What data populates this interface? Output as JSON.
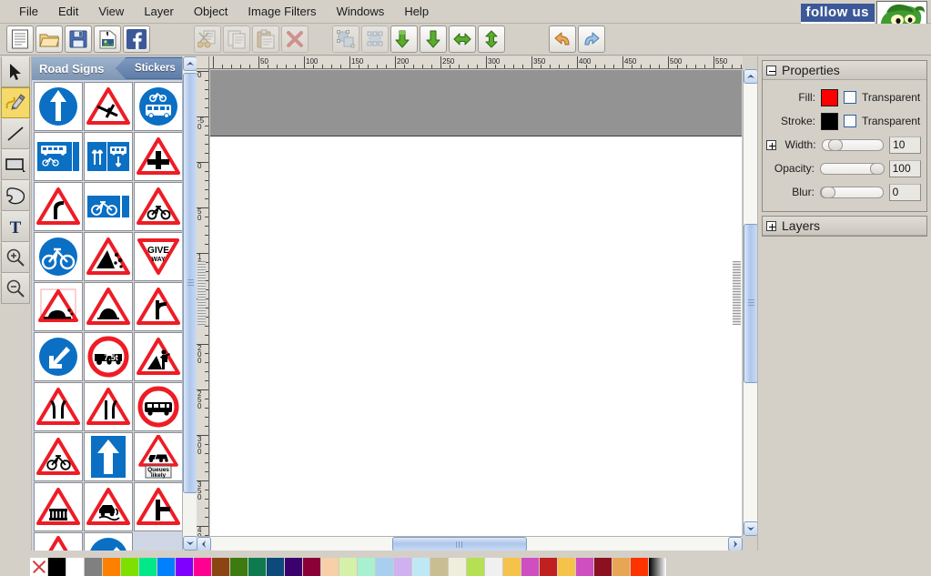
{
  "app": {
    "menu": [
      "File",
      "Edit",
      "View",
      "Layer",
      "Object",
      "Image Filters",
      "Windows",
      "Help"
    ]
  },
  "toolbar": {
    "buttons": [
      {
        "name": "new-document-button",
        "icon": "document-icon",
        "enabled": true
      },
      {
        "name": "open-folder-button",
        "icon": "folder-icon",
        "enabled": true
      },
      {
        "name": "save-button",
        "icon": "floppy-disk-icon",
        "enabled": true
      },
      {
        "name": "save-image-button",
        "icon": "image-export-icon",
        "enabled": true
      },
      {
        "name": "facebook-share-button",
        "icon": "facebook-icon",
        "enabled": true
      },
      {
        "name": "cut-button",
        "icon": "scissors-icon",
        "enabled": false
      },
      {
        "name": "copy-button",
        "icon": "copy-icon",
        "enabled": false
      },
      {
        "name": "paste-button",
        "icon": "clipboard-icon",
        "enabled": false
      },
      {
        "name": "delete-button",
        "icon": "red-x-icon",
        "enabled": false
      },
      {
        "name": "select-all-button",
        "icon": "select-shapes-icon",
        "enabled": false
      },
      {
        "name": "select-nodes-button",
        "icon": "node-points-icon",
        "enabled": false
      },
      {
        "name": "send-backward-button",
        "icon": "green-arrow-down-left-icon",
        "enabled": true
      },
      {
        "name": "send-to-back-button",
        "icon": "green-arrow-down-icon",
        "enabled": true
      },
      {
        "name": "flip-horizontal-button",
        "icon": "green-arrow-horizontal-icon",
        "enabled": true
      },
      {
        "name": "flip-vertical-button",
        "icon": "green-arrow-vertical-icon",
        "enabled": true
      },
      {
        "name": "undo-button",
        "icon": "undo-arrow-icon",
        "enabled": true
      },
      {
        "name": "redo-button",
        "icon": "redo-arrow-icon",
        "enabled": true
      }
    ]
  },
  "tools": [
    {
      "name": "tool-select",
      "icon": "cursor-arrow-icon",
      "active": false
    },
    {
      "name": "tool-pencil",
      "icon": "pencil-icon",
      "active": true
    },
    {
      "name": "tool-line",
      "icon": "line-icon",
      "active": false
    },
    {
      "name": "tool-rectangle",
      "icon": "rectangle-icon",
      "active": false
    },
    {
      "name": "tool-freeform",
      "icon": "blob-shape-icon",
      "active": false
    },
    {
      "name": "tool-text",
      "icon": "text-t-icon",
      "active": false
    },
    {
      "name": "tool-zoom-in",
      "icon": "magnifier-plus-icon",
      "active": false
    },
    {
      "name": "tool-zoom-out",
      "icon": "magnifier-minus-icon",
      "active": false
    }
  ],
  "stickers": {
    "title": "Road Signs",
    "tab_label": "Stickers",
    "items": [
      {
        "name": "sticker-ahead-only",
        "kind": "blue-circle-up-arrow"
      },
      {
        "name": "sticker-low-flying-aircraft",
        "kind": "triangle-aircraft"
      },
      {
        "name": "sticker-bus-and-cycle-lane",
        "kind": "blue-circle-bus-cycle"
      },
      {
        "name": "sticker-bus-cycle-lane-ahead",
        "kind": "blue-rect-bus-cycle"
      },
      {
        "name": "sticker-contraflow-bus-lane",
        "kind": "blue-rect-arrows-bus"
      },
      {
        "name": "sticker-crossroads",
        "kind": "triangle-crossroads"
      },
      {
        "name": "sticker-bend-to-right",
        "kind": "triangle-bend"
      },
      {
        "name": "sticker-cycle-route",
        "kind": "blue-rect-cycle"
      },
      {
        "name": "sticker-cycle-crossing",
        "kind": "triangle-cycle"
      },
      {
        "name": "sticker-cycle-only-route",
        "kind": "blue-circle-cycle"
      },
      {
        "name": "sticker-falling-rocks",
        "kind": "triangle-falling-rocks"
      },
      {
        "name": "sticker-give-way",
        "kind": "inverted-triangle-give-way"
      },
      {
        "name": "sticker-loose-chippings",
        "kind": "triangle-loose-chippings"
      },
      {
        "name": "sticker-hump-bridge",
        "kind": "triangle-hump-bridge"
      },
      {
        "name": "sticker-t-junction",
        "kind": "triangle-t-junction"
      },
      {
        "name": "sticker-keep-left",
        "kind": "blue-circle-diagonal-arrow"
      },
      {
        "name": "sticker-no-goods-vehicles-7-5t",
        "kind": "red-circle-lorry-7.5t"
      },
      {
        "name": "sticker-roadworks",
        "kind": "triangle-roadworks"
      },
      {
        "name": "sticker-road-narrows-both-sides",
        "kind": "triangle-narrows-both"
      },
      {
        "name": "sticker-road-narrows-right",
        "kind": "triangle-narrows-right"
      },
      {
        "name": "sticker-no-buses",
        "kind": "red-circle-bus"
      },
      {
        "name": "sticker-cycle-warning",
        "kind": "triangle-cycle-warning"
      },
      {
        "name": "sticker-one-way-traffic",
        "kind": "blue-rect-up-arrow"
      },
      {
        "name": "sticker-queues-likely",
        "kind": "triangle-queues-likely"
      },
      {
        "name": "sticker-level-crossing-gate",
        "kind": "triangle-gate"
      },
      {
        "name": "sticker-slippery-road",
        "kind": "triangle-slippery"
      },
      {
        "name": "sticker-side-road-right",
        "kind": "triangle-side-road"
      },
      {
        "name": "sticker-partial-triangle",
        "kind": "triangle-partial"
      },
      {
        "name": "sticker-partial-blue-arrow",
        "kind": "blue-circle-partial"
      }
    ],
    "queues_text_line1": "Queues",
    "queues_text_line2": "likely",
    "give_way_line1": "GIVE",
    "give_way_line2": "WAY",
    "weight_limit_label": "7.5t"
  },
  "rulers": {
    "horizontal_ticks": [
      "50",
      "100",
      "150",
      "200",
      "250",
      "300",
      "350",
      "400",
      "450",
      "500",
      "550"
    ],
    "vertical_ticks": [
      "0",
      "-50",
      "0",
      "50",
      "100",
      "150",
      "200",
      "250",
      "300",
      "350",
      "400"
    ],
    "origin_label": "0"
  },
  "properties": {
    "section_title": "Properties",
    "fill_label": "Fill:",
    "fill_color": "#ff0000",
    "fill_transparent_label": "Transparent",
    "fill_transparent_checked": false,
    "stroke_label": "Stroke:",
    "stroke_color": "#000000",
    "stroke_transparent_label": "Transparent",
    "stroke_transparent_checked": false,
    "width_label": "Width:",
    "width_value": "10",
    "width_percent": 12,
    "opacity_label": "Opacity:",
    "opacity_value": "100",
    "opacity_percent": 100,
    "blur_label": "Blur:",
    "blur_value": "0",
    "blur_percent": 0
  },
  "layers": {
    "section_title": "Layers"
  },
  "branding": {
    "follow_us": "follow us",
    "mascot": "green-dragon-mascot-icon"
  },
  "palette": {
    "colors": [
      "#000000",
      "#ffffff",
      "#808080",
      "#ff8000",
      "#7fe000",
      "#00e887",
      "#0080ff",
      "#8000ff",
      "#ff0090",
      "#8b4513",
      "#3d7a10",
      "#0f7a4f",
      "#0b4a7a",
      "#3a006e",
      "#8b0038",
      "#f7cfa8",
      "#d5f0a8",
      "#a8f0cf",
      "#a8cff0",
      "#d0b0f0",
      "#bfe8f5",
      "#c9bd92",
      "#efeddc",
      "#b5e054",
      "#f0f0f0",
      "#f5c24a",
      "#cf4fc0",
      "#c02020",
      "#f5c24a",
      "#cf4fc0",
      "#8b1020",
      "#e8a655",
      "#ff3300"
    ],
    "none_swatch_name": "transparent-swatch",
    "gradient_swatch_name": "gradient-swatch"
  }
}
